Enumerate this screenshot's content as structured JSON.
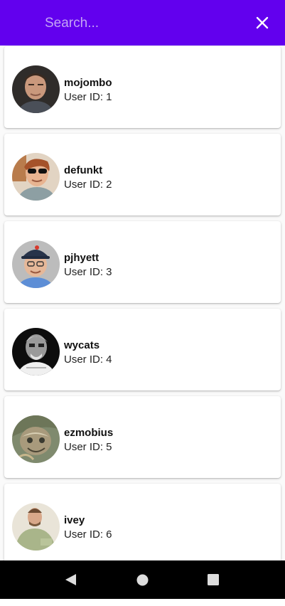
{
  "search": {
    "placeholder": "Search...",
    "value": ""
  },
  "icons": {
    "close": "close-icon",
    "back": "nav-back-icon",
    "home": "nav-home-icon",
    "recents": "nav-recents-icon"
  },
  "colors": {
    "app_bar": "#6200ee",
    "nav_bar": "#000000"
  },
  "users": [
    {
      "name": "mojombo",
      "id_text": "User ID: 1"
    },
    {
      "name": "defunkt",
      "id_text": "User ID: 2"
    },
    {
      "name": "pjhyett",
      "id_text": "User ID: 3"
    },
    {
      "name": "wycats",
      "id_text": "User ID: 4"
    },
    {
      "name": "ezmobius",
      "id_text": "User ID: 5"
    },
    {
      "name": "ivey",
      "id_text": "User ID: 6"
    }
  ]
}
